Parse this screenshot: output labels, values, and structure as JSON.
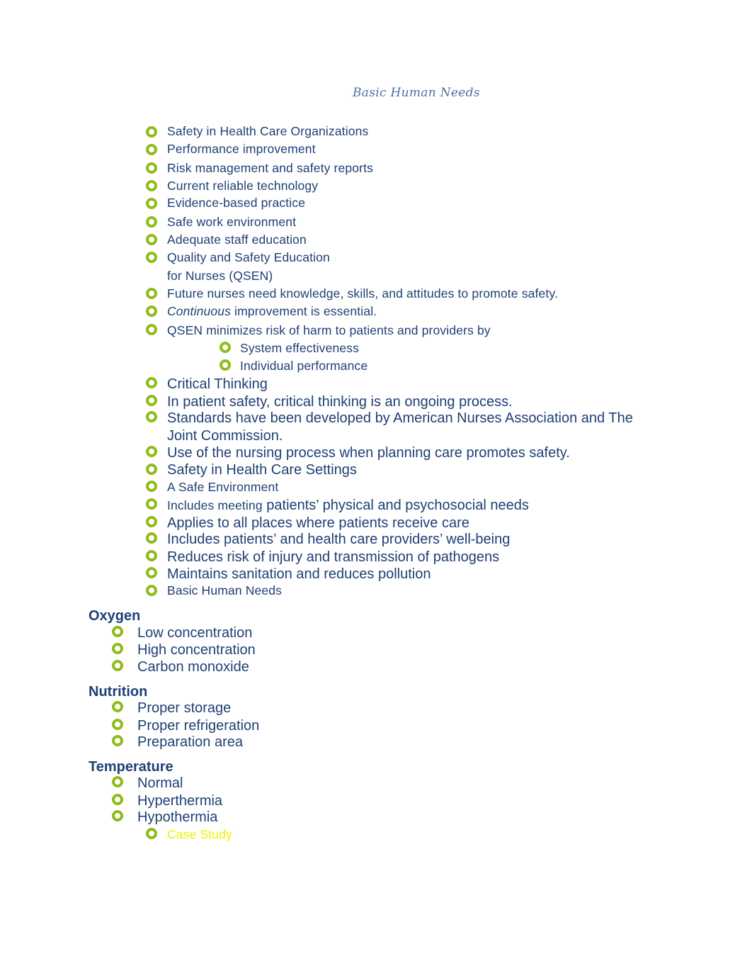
{
  "document": {
    "title": "Basic Human Needs",
    "accent_color": "#8ebc1a",
    "text_color": "#1f3f75",
    "items": [
      {
        "text": "Safety in Health Care Organizations"
      },
      {
        "text": "Performance improvement"
      },
      {
        "text": "Risk management and safety reports"
      },
      {
        "text": "Current reliable technology"
      },
      {
        "text": "Evidence-based practice"
      },
      {
        "text": "Safe work environment"
      },
      {
        "text": "Adequate staff education"
      },
      {
        "text": "Quality and Safety Education",
        "text2": "for Nurses (QSEN)"
      },
      {
        "text": "Future nurses need knowledge, skills, and attitudes to promote safety."
      },
      {
        "italic": "Continuous",
        "text": " improvement is essential."
      },
      {
        "text": "QSEN minimizes risk of harm to patients and providers by"
      },
      {
        "text": "System effectiveness"
      },
      {
        "text": "Individual performance"
      },
      {
        "text": "Critical Thinking"
      },
      {
        "text": "In patient safety, critical thinking is an ongoing process."
      },
      {
        "text": "Standards have been developed by American Nurses Association and The",
        "text2": "Joint Commission."
      },
      {
        "text": "Use of the nursing process when planning care promotes safety."
      },
      {
        "text": "Safety in Health Care Settings"
      },
      {
        "text": "A Safe Environment"
      },
      {
        "prefix": "Includes meeting",
        "text": " patients’ physical and psychosocial needs"
      },
      {
        "text": "Applies to all places where patients receive care"
      },
      {
        "text": "Includes patients’ and health care providers’ well-being"
      },
      {
        "text": "Reduces risk of injury and transmission of pathogens"
      },
      {
        "text": "Maintains sanitation and reduces pollution"
      },
      {
        "text": "Basic Human Needs"
      }
    ],
    "sections": [
      {
        "heading": "Oxygen",
        "items": [
          "Low concentration",
          "High concentration",
          "Carbon monoxide"
        ]
      },
      {
        "heading": "Nutrition",
        "items": [
          "Proper storage",
          "Proper refrigeration",
          "Preparation area"
        ]
      },
      {
        "heading": "Temperature",
        "items": [
          "Normal",
          "Hyperthermia",
          "Hypothermia"
        ],
        "subitem": "Case Study"
      }
    ]
  }
}
